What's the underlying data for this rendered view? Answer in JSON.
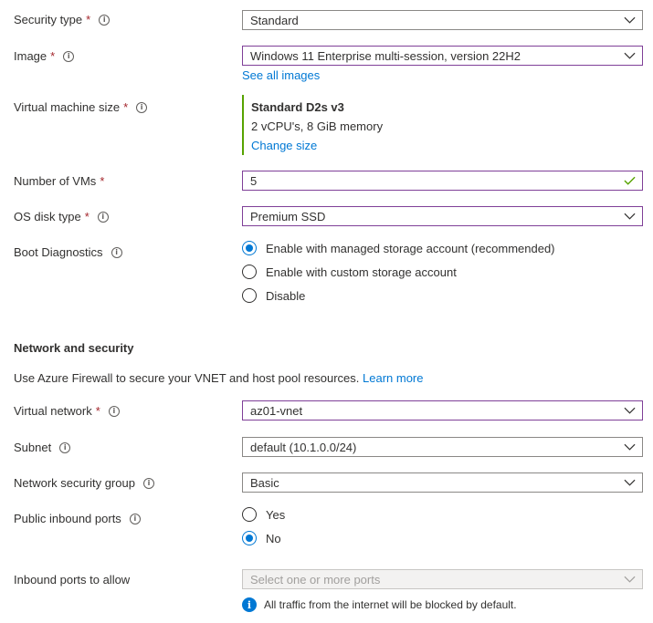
{
  "security_type": {
    "label": "Security type",
    "required": "*",
    "value": "Standard"
  },
  "image": {
    "label": "Image",
    "required": "*",
    "value": "Windows 11 Enterprise multi-session, version 22H2",
    "link": "See all images"
  },
  "vm_size": {
    "label": "Virtual machine size",
    "required": "*",
    "name": "Standard D2s v3",
    "specs": "2 vCPU's, 8 GiB memory",
    "link": "Change size"
  },
  "num_vms": {
    "label": "Number of VMs",
    "required": "*",
    "value": "5"
  },
  "os_disk": {
    "label": "OS disk type",
    "required": "*",
    "value": "Premium SSD"
  },
  "boot_diag": {
    "label": "Boot Diagnostics",
    "options": [
      "Enable with managed storage account (recommended)",
      "Enable with custom storage account",
      "Disable"
    ],
    "selected_index": 0
  },
  "network_section": {
    "title": "Network and security",
    "description": "Use Azure Firewall to secure your VNET and host pool resources.",
    "link": "Learn more"
  },
  "vnet": {
    "label": "Virtual network",
    "required": "*",
    "value": "az01-vnet"
  },
  "subnet": {
    "label": "Subnet",
    "value": "default (10.1.0.0/24)"
  },
  "nsg": {
    "label": "Network security group",
    "value": "Basic"
  },
  "public_ports": {
    "label": "Public inbound ports",
    "options": [
      "Yes",
      "No"
    ],
    "selected_index": 1
  },
  "inbound_ports": {
    "label": "Inbound ports to allow",
    "placeholder": "Select one or more ports"
  },
  "note": {
    "text": "All traffic from the internet will be blocked by default."
  },
  "colors": {
    "accent": "#0078d4",
    "focus_border": "#7f3f98",
    "success": "#57a300",
    "required": "#a4262c"
  }
}
